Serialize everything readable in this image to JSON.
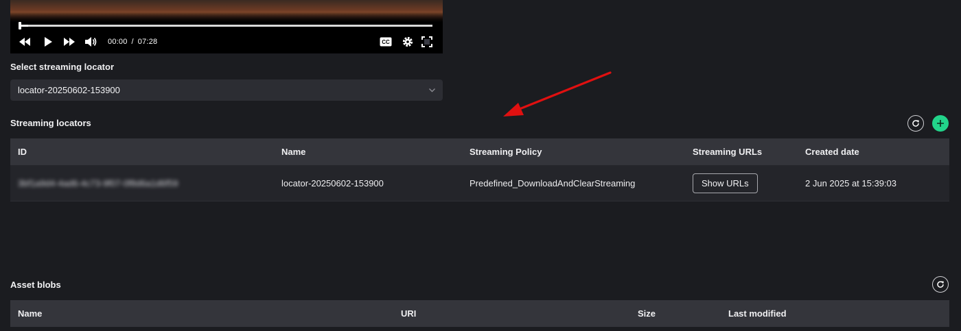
{
  "player": {
    "current_time": "00:00",
    "separator": "/",
    "duration": "07:28",
    "progress_fraction": 0.02,
    "icons": {
      "rewind": "rewind-icon",
      "play": "play-icon",
      "forward": "fast-forward-icon",
      "volume": "volume-icon",
      "captions": "closed-captions-icon",
      "settings": "gear-icon",
      "fullscreen": "fullscreen-icon"
    },
    "captions_label": "CC"
  },
  "locator_select": {
    "label": "Select streaming locator",
    "selected": "locator-20250602-153900"
  },
  "streaming_locators": {
    "title": "Streaming locators",
    "columns": [
      "ID",
      "Name",
      "Streaming Policy",
      "Streaming URLs",
      "Created date"
    ],
    "rows": [
      {
        "id": "3bf1a9d4-4ad6-4c73-9f07-0f8d6a1d6f59",
        "name": "locator-20250602-153900",
        "policy": "Predefined_DownloadAndClearStreaming",
        "urls_button": "Show URLs",
        "created": "2 Jun 2025 at 15:39:03"
      }
    ]
  },
  "asset_blobs": {
    "title": "Asset blobs",
    "columns": [
      "Name",
      "URI",
      "Size",
      "Last modified"
    ]
  },
  "colors": {
    "background": "#1b1c20",
    "header_row": "#34353b",
    "body_row": "#24252a",
    "accent_green": "#22d48a",
    "annotation_arrow": "#e01010"
  }
}
